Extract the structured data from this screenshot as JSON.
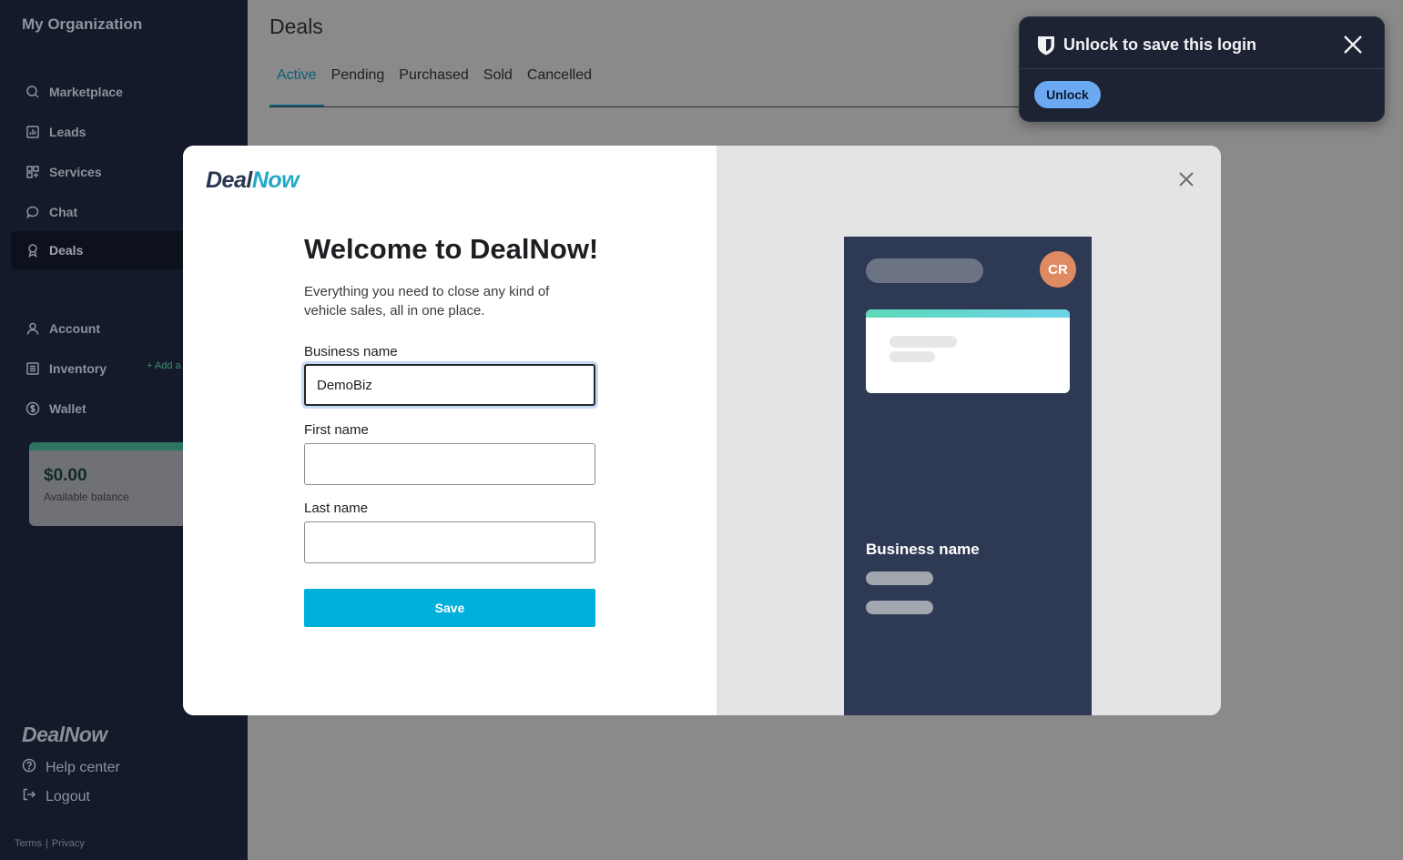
{
  "sidebar": {
    "org_name": "My Organization",
    "nav": [
      {
        "label": "Marketplace",
        "icon": "search-icon"
      },
      {
        "label": "Leads",
        "icon": "chart-icon"
      },
      {
        "label": "Services",
        "icon": "grid-icon"
      },
      {
        "label": "Chat",
        "icon": "chat-icon"
      },
      {
        "label": "Deals",
        "icon": "ribbon-icon"
      },
      {
        "label": "Account",
        "icon": "user-icon"
      },
      {
        "label": "Inventory",
        "icon": "list-icon"
      },
      {
        "label": "Wallet",
        "icon": "dollar-icon"
      }
    ],
    "add_link": "+ Add a",
    "balance": {
      "amount": "$0.00",
      "label": "Available balance"
    },
    "logo": "DealNow",
    "help": "Help center",
    "logout": "Logout",
    "terms": "Terms",
    "separator": "|",
    "privacy": "Privacy"
  },
  "main": {
    "title": "Deals",
    "tabs": [
      "Active",
      "Pending",
      "Purchased",
      "Sold",
      "Cancelled"
    ]
  },
  "modal": {
    "logo_deal": "Deal",
    "logo_now": "Now",
    "heading": "Welcome to DealNow!",
    "subtitle": "Everything you need to close any kind of vehicle sales, all in one place.",
    "business_label": "Business name",
    "business_value": "DemoBiz",
    "first_label": "First name",
    "first_value": "",
    "last_label": "Last name",
    "last_value": "",
    "save_label": "Save",
    "preview": {
      "avatar_initials": "CR",
      "business_name": "Business name"
    }
  },
  "password_manager": {
    "title": "Unlock to save this login",
    "unlock_label": "Unlock"
  },
  "colors": {
    "accent": "#00b0dc",
    "sidebar_bg": "#141a2a",
    "active_tab": "#0c5f78",
    "avatar": "#e08a62"
  }
}
